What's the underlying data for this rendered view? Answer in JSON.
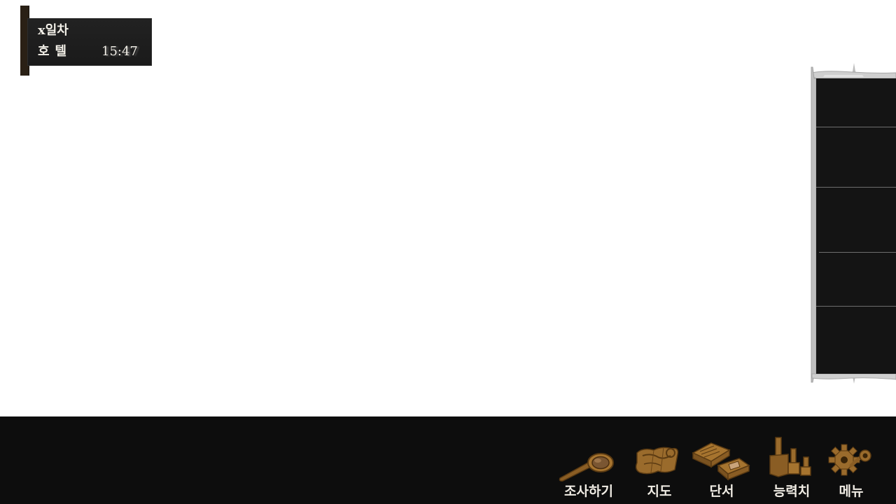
{
  "status": {
    "day": "x일차",
    "location": "호텔",
    "time": "15:47"
  },
  "toolbar": {
    "investigate_label": "조사하기",
    "map_label": "지도",
    "clues_label": "단서",
    "stats_label": "능력치",
    "menu_label": "메뉴"
  },
  "icons": {
    "investigate": "magnifying-glass-icon",
    "map": "map-icon",
    "clues": "documents-icon",
    "stats": "trophy-icon",
    "menu": "gear-icon"
  },
  "colors": {
    "toolbar_bg": "#0d0d0d",
    "icon_gold": "#9a6b2c",
    "board": "#141414"
  }
}
